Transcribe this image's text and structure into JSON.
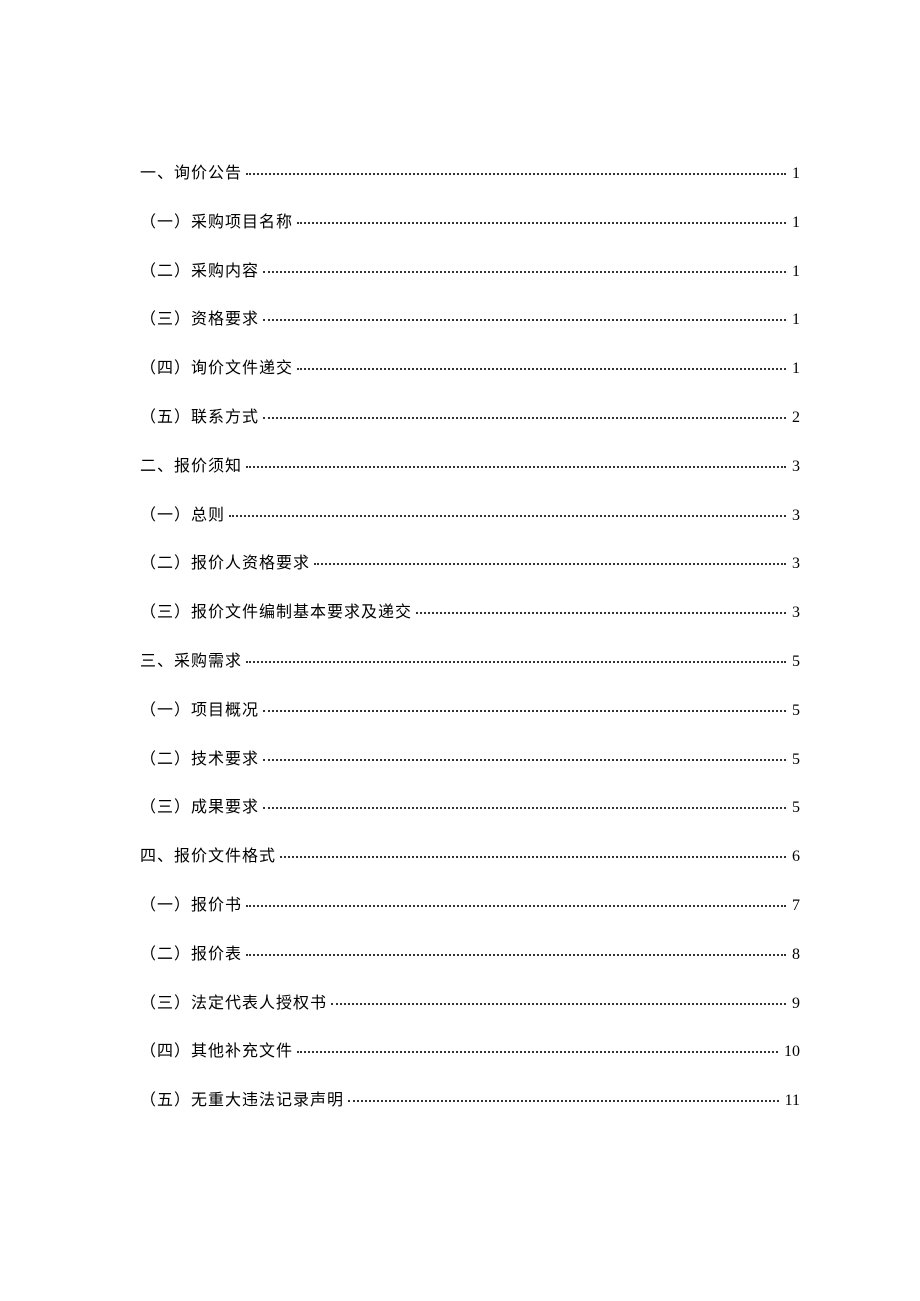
{
  "toc": [
    {
      "label": "一、询价公告",
      "page": "1"
    },
    {
      "label": "（一）采购项目名称",
      "page": "1"
    },
    {
      "label": "（二）采购内容",
      "page": "1"
    },
    {
      "label": "（三）资格要求",
      "page": "1"
    },
    {
      "label": "（四）询价文件递交",
      "page": "1"
    },
    {
      "label": "（五）联系方式",
      "page": "2"
    },
    {
      "label": "二、报价须知",
      "page": "3"
    },
    {
      "label": "（一）总则",
      "page": "3"
    },
    {
      "label": "（二）报价人资格要求",
      "page": "3"
    },
    {
      "label": "（三）报价文件编制基本要求及递交",
      "page": "3"
    },
    {
      "label": "三、采购需求",
      "page": "5"
    },
    {
      "label": "（一）项目概况",
      "page": "5"
    },
    {
      "label": "（二）技术要求",
      "page": "5"
    },
    {
      "label": "（三）成果要求",
      "page": "5"
    },
    {
      "label": "四、报价文件格式",
      "page": "6"
    },
    {
      "label": "（一）报价书",
      "page": "7"
    },
    {
      "label": "（二）报价表",
      "page": "8"
    },
    {
      "label": "（三）法定代表人授权书",
      "page": "9"
    },
    {
      "label": "（四）其他补充文件",
      "page": "10"
    },
    {
      "label": "（五）无重大违法记录声明",
      "page": "11"
    }
  ]
}
